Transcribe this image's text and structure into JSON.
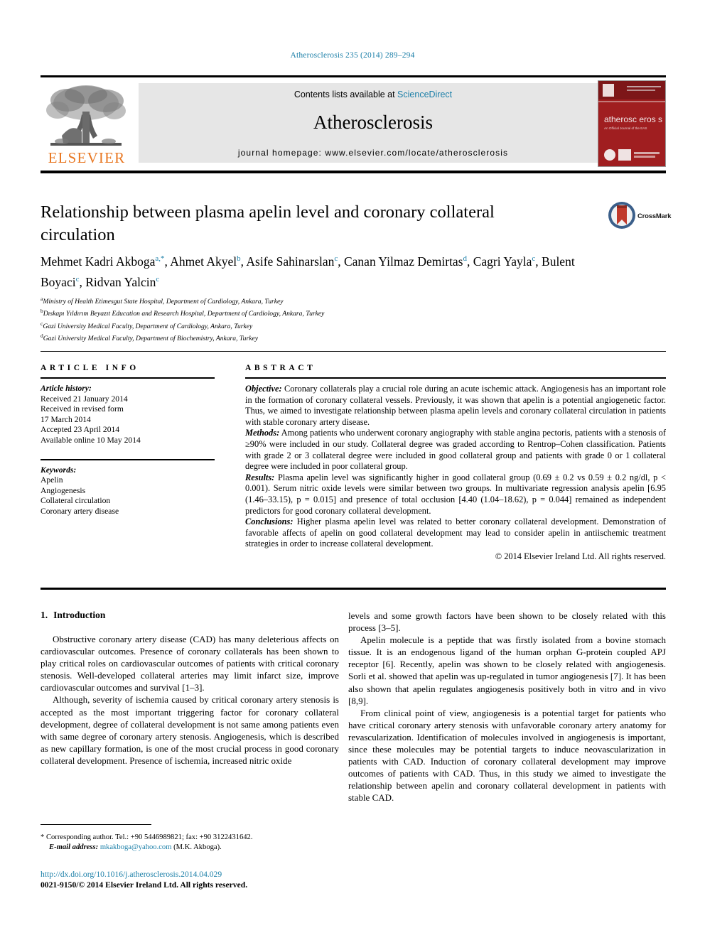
{
  "running_head": "Atherosclerosis 235 (2014) 289–294",
  "masthead": {
    "contents_prefix": "Contents lists available at ",
    "sciencedirect": "ScienceDirect",
    "journal_name": "Atherosclerosis",
    "homepage": "journal homepage: www.elsevier.com/locate/atherosclerosis",
    "publisher": "ELSEVIER",
    "cover_title": "atherosc eros s",
    "cover_subtitle": "An Official Journal of the European Atherosclerosis Society"
  },
  "article": {
    "title": "Relationship between plasma apelin level and coronary collateral circulation",
    "crossmark_label": "CrossMark",
    "authors": [
      {
        "name": "Mehmet Kadri Akboga",
        "marks": "a,*",
        "sep": ", "
      },
      {
        "name": "Ahmet Akyel",
        "marks": "b",
        "sep": ", "
      },
      {
        "name": "Asife Sahinarslan",
        "marks": "c",
        "sep": ", "
      },
      {
        "name": "Canan Yilmaz Demirtas",
        "marks": "d",
        "sep": ", "
      },
      {
        "name": "Cagri Yayla",
        "marks": "c",
        "sep": ", "
      },
      {
        "name": "Bulent Boyaci",
        "marks": "c",
        "sep": ", "
      },
      {
        "name": "Ridvan Yalcin",
        "marks": "c",
        "sep": ""
      }
    ],
    "affiliations": [
      {
        "mark": "a",
        "text": "Ministry of Health Etimesgut State Hospital, Department of Cardiology, Ankara, Turkey"
      },
      {
        "mark": "b",
        "text": "Dıskapı Yıldırım Beyazıt Education and Research Hospital, Department of Cardiology, Ankara, Turkey"
      },
      {
        "mark": "c",
        "text": "Gazi University Medical Faculty, Department of Cardiology, Ankara, Turkey"
      },
      {
        "mark": "d",
        "text": "Gazi University Medical Faculty, Department of Biochemistry, Ankara, Turkey"
      }
    ]
  },
  "article_info": {
    "heading": "ARTICLE INFO",
    "history_label": "Article history:",
    "history": [
      "Received 21 January 2014",
      "Received in revised form",
      "17 March 2014",
      "Accepted 23 April 2014",
      "Available online 10 May 2014"
    ],
    "keywords_label": "Keywords:",
    "keywords": [
      "Apelin",
      "Angiogenesis",
      "Collateral circulation",
      "Coronary artery disease"
    ]
  },
  "abstract": {
    "heading": "ABSTRACT",
    "objective_label": "Objective:",
    "objective_text": " Coronary collaterals play a crucial role during an acute ischemic attack. Angiogenesis has an important role in the formation of coronary collateral vessels. Previously, it was shown that apelin is a potential angiogenetic factor. Thus, we aimed to investigate relationship between plasma apelin levels and coronary collateral circulation in patients with stable coronary artery disease.",
    "methods_label": "Methods:",
    "methods_text": " Among patients who underwent coronary angiography with stable angina pectoris, patients with a stenosis of ≥90% were included in our study. Collateral degree was graded according to Rentrop–Cohen classification. Patients with grade 2 or 3 collateral degree were included in good collateral group and patients with grade 0 or 1 collateral degree were included in poor collateral group.",
    "results_label": "Results:",
    "results_text": " Plasma apelin level was significantly higher in good collateral group (0.69 ± 0.2 vs 0.59 ± 0.2 ng/dl, p < 0.001). Serum nitric oxide levels were similar between two groups. In multivariate regression analysis apelin [6.95 (1.46–33.15), p = 0.015] and presence of total occlusion [4.40 (1.04–18.62), p = 0.044] remained as independent predictors for good coronary collateral development.",
    "conclusions_label": "Conclusions:",
    "conclusions_text": " Higher plasma apelin level was related to better coronary collateral development. Demonstration of favorable affects of apelin on good collateral development may lead to consider apelin in antiischemic treatment strategies in order to increase collateral development.",
    "copyright": "© 2014 Elsevier Ireland Ltd. All rights reserved."
  },
  "introduction": {
    "number": "1.",
    "heading": "Introduction",
    "paragraphs_left": [
      "Obstructive coronary artery disease (CAD) has many deleterious affects on cardiovascular outcomes. Presence of coronary collaterals has been shown to play critical roles on cardiovascular outcomes of patients with critical coronary stenosis. Well-developed collateral arteries may limit infarct size, improve cardiovascular outcomes and survival [1–3].",
      "Although, severity of ischemia caused by critical coronary artery stenosis is accepted as the most important triggering factor for coronary collateral development, degree of collateral development is not same among patients even with same degree of coronary artery stenosis. Angiogenesis, which is described as new capillary formation, is one of the most crucial process in good coronary collateral development. Presence of ischemia, increased nitric oxide"
    ],
    "paragraphs_right": [
      "levels and some growth factors have been shown to be closely related with this process [3–5].",
      "Apelin molecule is a peptide that was firstly isolated from a bovine stomach tissue. It is an endogenous ligand of the human orphan G-protein coupled APJ receptor [6]. Recently, apelin was shown to be closely related with angiogenesis. Sorli et al. showed that apelin was up-regulated in tumor angiogenesis [7]. It has been also shown that apelin regulates angiogenesis positively both in vitro and in vivo [8,9].",
      "From clinical point of view, angiogenesis is a potential target for patients who have critical coronary artery stenosis with unfavorable coronary artery anatomy for revascularization. Identification of molecules involved in angiogenesis is important, since these molecules may be potential targets to induce neovascularization in patients with CAD. Induction of coronary collateral development may improve outcomes of patients with CAD. Thus, in this study we aimed to investigate the relationship between apelin and coronary collateral development in patients with stable CAD."
    ]
  },
  "footer": {
    "corresponding": "* Corresponding author. Tel.: +90 5446989821; fax: +90 3122431642.",
    "email_label": "E-mail address:",
    "email": "mkakboga@yahoo.com",
    "email_suffix": " (M.K. Akboga).",
    "doi": "http://dx.doi.org/10.1016/j.atherosclerosis.2014.04.029",
    "issn_line": "0021-9150/© 2014 Elsevier Ireland Ltd. All rights reserved."
  },
  "colors": {
    "link": "#1b7fa8",
    "elsevier_orange": "#E87722",
    "cover_red": "#A01E20",
    "band_gray": "#e6e6e6"
  }
}
